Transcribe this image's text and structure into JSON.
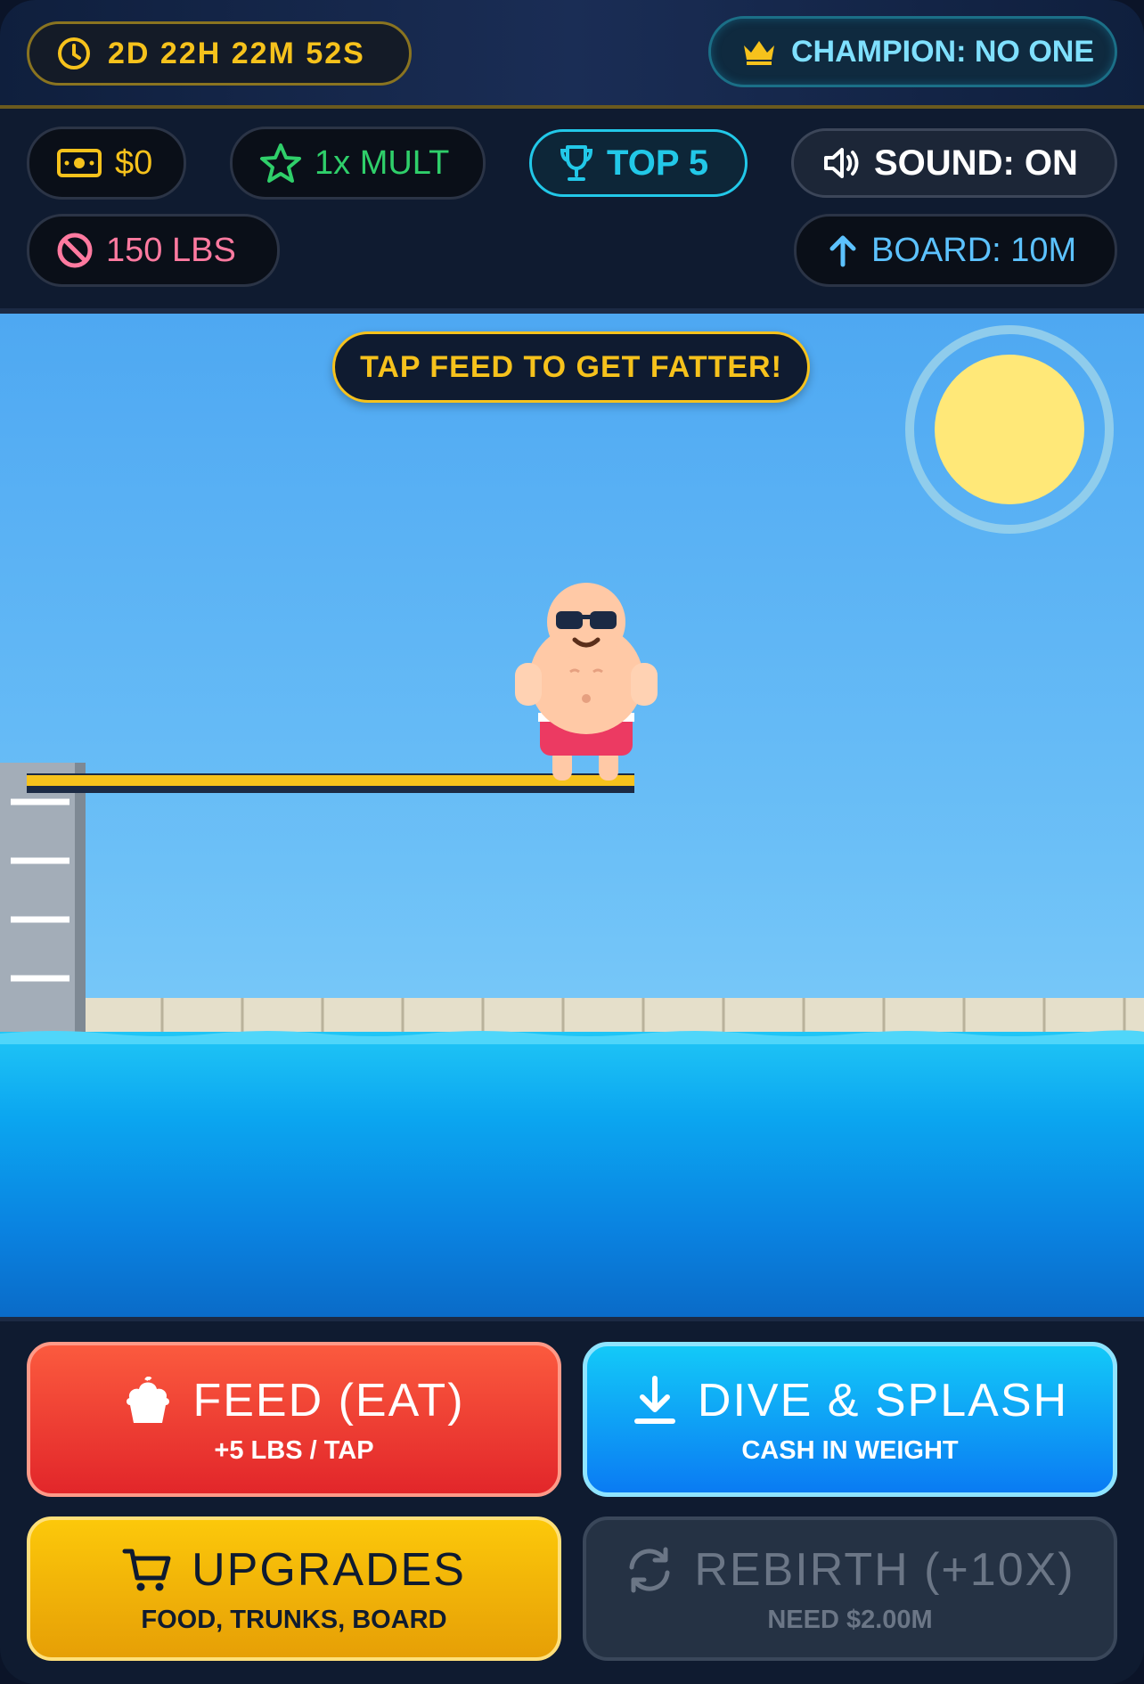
{
  "header": {
    "timer": "2D 22H 22M 52S",
    "champion": "CHAMPION: NO ONE"
  },
  "stats": {
    "cash": "$0",
    "multiplier": "1x MULT",
    "top": "TOP 5",
    "sound": "SOUND: ON",
    "weight": "150 LBS",
    "board": "BOARD: 10M"
  },
  "scene": {
    "hint": "TAP FEED TO GET FATTER!"
  },
  "controls": {
    "feed": {
      "title": "FEED (EAT)",
      "subtitle": "+5 LBS / TAP"
    },
    "dive": {
      "title": "DIVE & SPLASH",
      "subtitle": "CASH IN WEIGHT"
    },
    "upgrades": {
      "title": "UPGRADES",
      "subtitle": "FOOD, TRUNKS, BOARD"
    },
    "rebirth": {
      "title": "REBIRTH (+10X)",
      "subtitle": "NEED $2.00M",
      "disabled": true
    }
  },
  "icons": [
    "clock-icon",
    "crown-icon",
    "cash-icon",
    "star-icon",
    "trophy-icon",
    "speaker-icon",
    "ban-icon",
    "arrow-up-icon",
    "sun",
    "muffin-icon",
    "download-icon",
    "cart-icon",
    "refresh-icon"
  ],
  "colors": {
    "gold": "#f6c21c",
    "cyan": "#22c8e8",
    "green": "#2fcf6a",
    "pink": "#ff7aa0",
    "feed": "#e8342d",
    "dive": "#0a9af5",
    "upgrades": "#f5b608",
    "rebirth": "#253244"
  }
}
